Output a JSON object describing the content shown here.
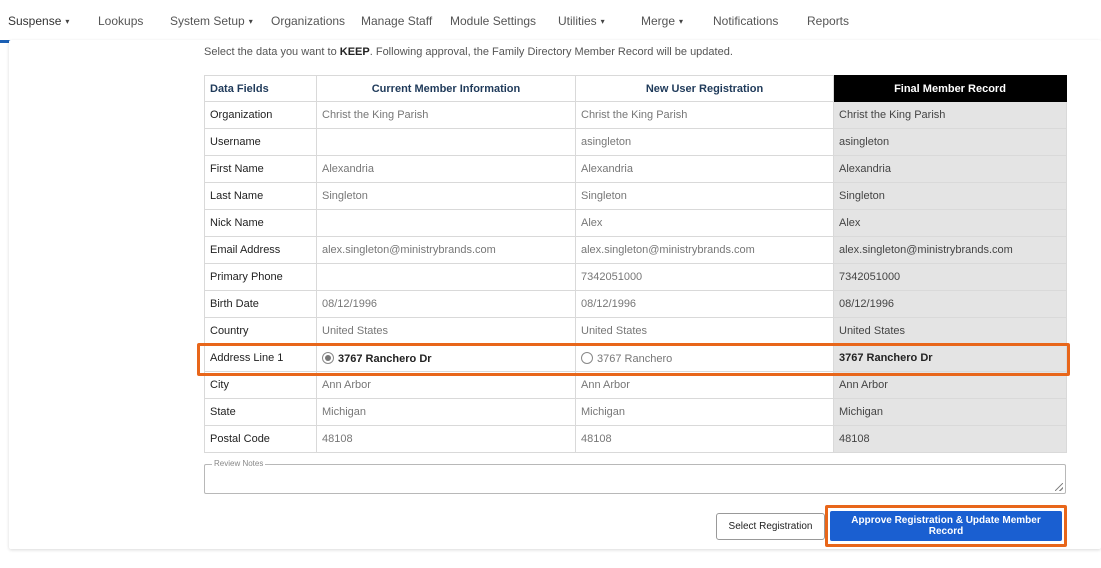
{
  "nav": {
    "items": [
      {
        "label": "Suspense",
        "caret": "▾",
        "active": true
      },
      {
        "label": "Lookups"
      },
      {
        "label": "System Setup",
        "caret": "▾"
      },
      {
        "label": "Organizations"
      },
      {
        "label": "Manage Staff"
      },
      {
        "label": "Module Settings"
      },
      {
        "label": "Utilities",
        "caret": "▾"
      },
      {
        "label": "Merge",
        "caret": "▾"
      },
      {
        "label": "Notifications"
      },
      {
        "label": "Reports"
      }
    ]
  },
  "instructions": {
    "prefix": "Select the data you want to ",
    "keyword": "KEEP",
    "suffix": ". Following approval, the Family Directory Member Record will be updated."
  },
  "table": {
    "headers": {
      "field": "Data Fields",
      "current": "Current Member Information",
      "new": "New User Registration",
      "final": "Final Member Record"
    },
    "rows": [
      {
        "field": "Organization",
        "current": "Christ the King Parish",
        "new": "Christ the King Parish",
        "final": "Christ the King Parish"
      },
      {
        "field": "Username",
        "current": "",
        "new": "asingleton",
        "final": "asingleton"
      },
      {
        "field": "First Name",
        "current": "Alexandria",
        "new": "Alexandria",
        "final": "Alexandria"
      },
      {
        "field": "Last Name",
        "current": "Singleton",
        "new": "Singleton",
        "final": "Singleton"
      },
      {
        "field": "Nick Name",
        "current": "",
        "new": "Alex",
        "final": "Alex"
      },
      {
        "field": "Email Address",
        "current": "alex.singleton@ministrybrands.com",
        "new": "alex.singleton@ministrybrands.com",
        "final": "alex.singleton@ministrybrands.com"
      },
      {
        "field": "Primary Phone",
        "current": "",
        "new": "7342051000",
        "final": "7342051000"
      },
      {
        "field": "Birth Date",
        "current": "08/12/1996",
        "new": "08/12/1996",
        "final": "08/12/1996"
      },
      {
        "field": "Country",
        "current": "United States",
        "new": "United States",
        "final": "United States"
      },
      {
        "field": "Address Line 1",
        "current": "3767 Ranchero Dr",
        "new": "3767 Ranchero",
        "final": "3767 Ranchero Dr",
        "selectable": true,
        "selected": "current"
      },
      {
        "field": "City",
        "current": "Ann Arbor",
        "new": "Ann Arbor",
        "final": "Ann Arbor"
      },
      {
        "field": "State",
        "current": "Michigan",
        "new": "Michigan",
        "final": "Michigan"
      },
      {
        "field": "Postal Code",
        "current": "48108",
        "new": "48108",
        "final": "48108"
      }
    ]
  },
  "review_notes": {
    "label": "Review Notes",
    "value": ""
  },
  "buttons": {
    "select": "Select Registration",
    "approve": "Approve Registration & Update Member Record"
  },
  "colors": {
    "highlight": "#e8661a",
    "primary": "#1a5fd1",
    "nav_active": "#1a5fb4"
  }
}
